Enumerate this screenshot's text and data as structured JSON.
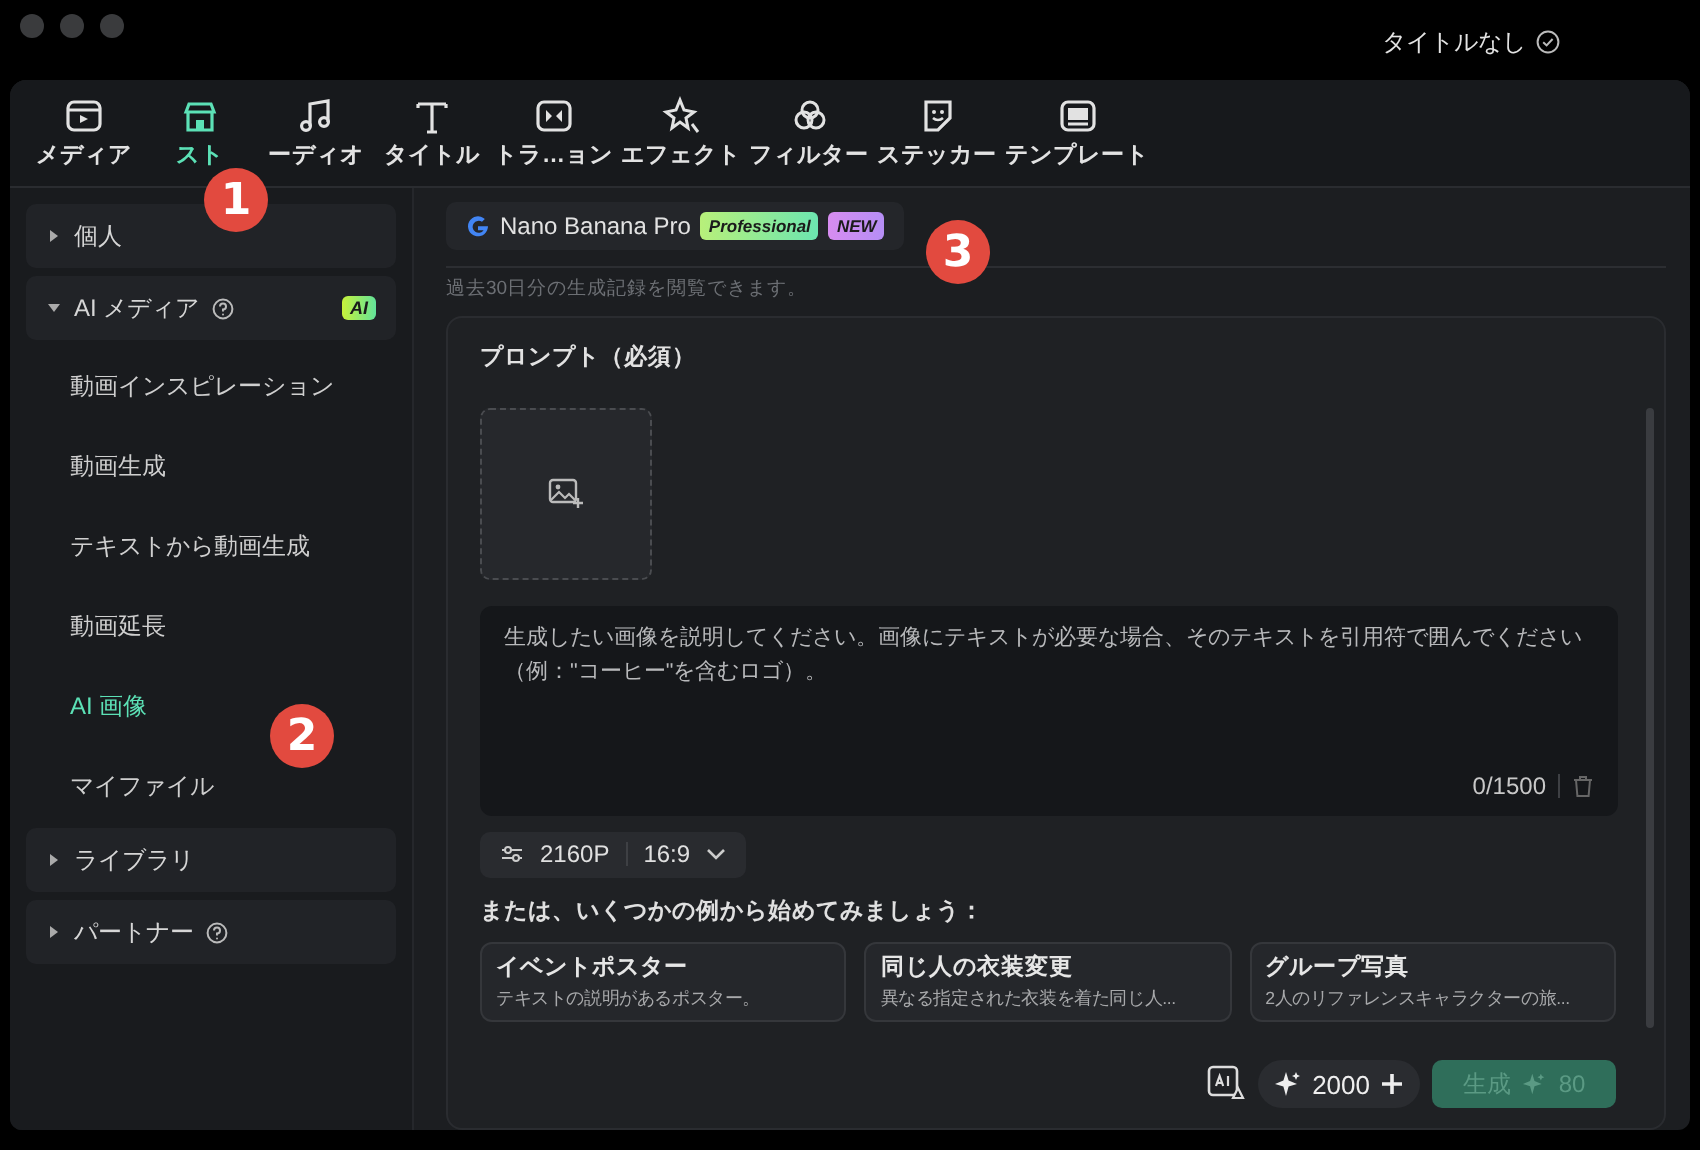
{
  "window": {
    "title": "タイトルなし",
    "saved": true
  },
  "toolbar": [
    {
      "label": "メディア",
      "selected": false
    },
    {
      "label": "スト",
      "selected": true
    },
    {
      "label": "ーディオ",
      "selected": false
    },
    {
      "label": "タイトル",
      "selected": false
    },
    {
      "label": "トラ…ョン",
      "selected": false
    },
    {
      "label": "エフェクト",
      "selected": false
    },
    {
      "label": "フィルター",
      "selected": false
    },
    {
      "label": "ステッカー",
      "selected": false
    },
    {
      "label": "テンプレート",
      "selected": false
    }
  ],
  "sidebar": {
    "items": [
      {
        "label": "個人",
        "expanded": false,
        "help": false
      },
      {
        "label": "AI メディア",
        "expanded": true,
        "help": true,
        "badge": "AI",
        "children": [
          {
            "label": "動画インスピレーション",
            "selected": false
          },
          {
            "label": "動画生成",
            "selected": false
          },
          {
            "label": "テキストから動画生成",
            "selected": false
          },
          {
            "label": "動画延長",
            "selected": false
          },
          {
            "label": "AI 画像",
            "selected": true
          },
          {
            "label": "マイファイル",
            "selected": false
          }
        ]
      },
      {
        "label": "ライブラリ",
        "expanded": false,
        "help": false
      },
      {
        "label": "パートナー",
        "expanded": false,
        "help": true
      }
    ]
  },
  "model": {
    "name": "Nano Banana Pro",
    "tags": [
      {
        "label": "Professional",
        "kind": "pro"
      },
      {
        "label": "NEW",
        "kind": "new"
      }
    ]
  },
  "history_hint": "過去30日分の生成記録を閲覧できます。",
  "prompt": {
    "title": "プロンプト（必須）",
    "placeholder": "生成したい画像を説明してください。画像にテキストが必要な場合、そのテキストを引用符で囲んでください（例：\"コーヒー\"を含むロゴ）。",
    "count": "0/1500"
  },
  "settings": {
    "resolution": "2160P",
    "ratio": "16:9"
  },
  "examples_heading": "または、いくつかの例から始めてみましょう：",
  "examples": [
    {
      "title": "イベントポスター",
      "description": "テキストの説明があるポスター。"
    },
    {
      "title": "同じ人の衣装変更",
      "description": "異なる指定された衣装を着た同じ人..."
    },
    {
      "title": "グループ写真",
      "description": "2人のリファレンスキャラクターの旅..."
    }
  ],
  "credits": "2000",
  "generate": {
    "label": "生成",
    "cost": "80",
    "disabled": true
  },
  "callouts": [
    "1",
    "2",
    "3"
  ]
}
